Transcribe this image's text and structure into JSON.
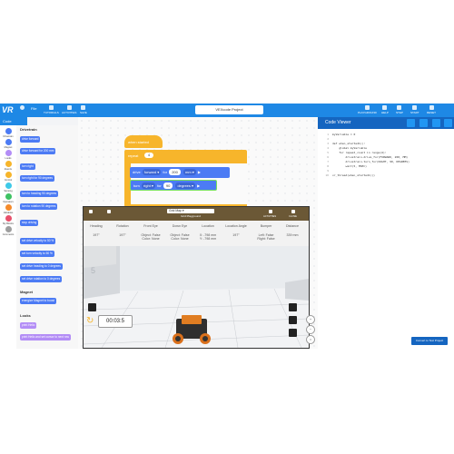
{
  "topbar": {
    "logo": "VR",
    "file": "File",
    "items": [
      "TUTORIALS",
      "ACTIVITIES",
      "SAVE"
    ],
    "project_name": "VEXcode Project",
    "right_items": [
      "PLAYGROUND",
      "HELP",
      "STEP",
      "START",
      "RESET"
    ]
  },
  "sidebar": {
    "code_tab": "Code",
    "categories": [
      {
        "label": "Drivetrain",
        "color": "#4c7bf4"
      },
      {
        "label": "Magnet",
        "color": "#4c7bf4"
      },
      {
        "label": "Looks",
        "color": "#b38df6"
      },
      {
        "label": "Events",
        "color": "#f7b52b"
      },
      {
        "label": "Control",
        "color": "#f7b52b"
      },
      {
        "label": "Sensing",
        "color": "#3ec9e8"
      },
      {
        "label": "Operators",
        "color": "#3fc263"
      },
      {
        "label": "Variables",
        "color": "#f58b2c"
      },
      {
        "label": "My Blocks",
        "color": "#e8506b"
      },
      {
        "label": "Comments",
        "color": "#9e9e9e"
      }
    ]
  },
  "palette": {
    "drivetrain_title": "Drivetrain",
    "blocks": [
      "drive forward",
      "drive forward for 200 mm",
      "turn right",
      "turn right for 90 degrees",
      "turn to heading 90 degrees",
      "turn to rotation 90 degrees",
      "stop driving",
      "set drive velocity to 50 %",
      "set turn velocity to 50 %",
      "set drive heading to 0 degrees",
      "set drive rotation to 0 degrees"
    ],
    "magnet_title": "Magnet",
    "magnet_block": "energize Magnet to boost",
    "looks_title": "Looks",
    "looks_blocks": [
      "print Hello",
      "print Hello and set cursor to next row"
    ]
  },
  "workspace": {
    "hat": "when started",
    "repeat_label": "repeat",
    "repeat_count": "4",
    "drive": {
      "word": "drive",
      "dir": "forward",
      "for": "for",
      "amount": "200",
      "unit": "mm"
    },
    "turn": {
      "word": "turn",
      "dir": "right",
      "for": "for",
      "amount": "90",
      "unit": "degrees"
    }
  },
  "playground": {
    "selector": "Grid Map",
    "name": "Grid Playground",
    "left_icons": [
      "",
      ""
    ],
    "right_icons": [
      "ACTIVITIES",
      "CLOSE"
    ],
    "stats": [
      {
        "header": "Heading",
        "value": "197°"
      },
      {
        "header": "Rotation",
        "value": "197°"
      },
      {
        "header": "Front Eye",
        "value": "Object: False\nColor: None"
      },
      {
        "header": "Down Eye",
        "value": "Object: False\nColor: None"
      },
      {
        "header": "Location",
        "value": "X: -798 mm\nY: -798 mm"
      },
      {
        "header": "Location Angle",
        "value": "197°"
      },
      {
        "header": "Bumper",
        "value": "Left: False\nRight: False"
      },
      {
        "header": "Distance",
        "value": "339 mm"
      }
    ],
    "timer": "00:03:5"
  },
  "viewer": {
    "title": "Code Viewer",
    "lines": [
      "myVariable = 0",
      "",
      "def when_started1():",
      "    global myVariable",
      "    for repeat_count in range(4):",
      "        drivetrain.drive_for(FORWARD, 200, MM)",
      "        drivetrain.turn_for(RIGHT, 90, DEGREES)",
      "        wait(5, MSEC)",
      "",
      "vr_thread(when_started1())"
    ],
    "convert_label": "Convert to Text Project"
  },
  "colors": {
    "accent": "#1e88e5",
    "drive_blue": "#4c7bf4",
    "control_yellow": "#f7b52b"
  }
}
